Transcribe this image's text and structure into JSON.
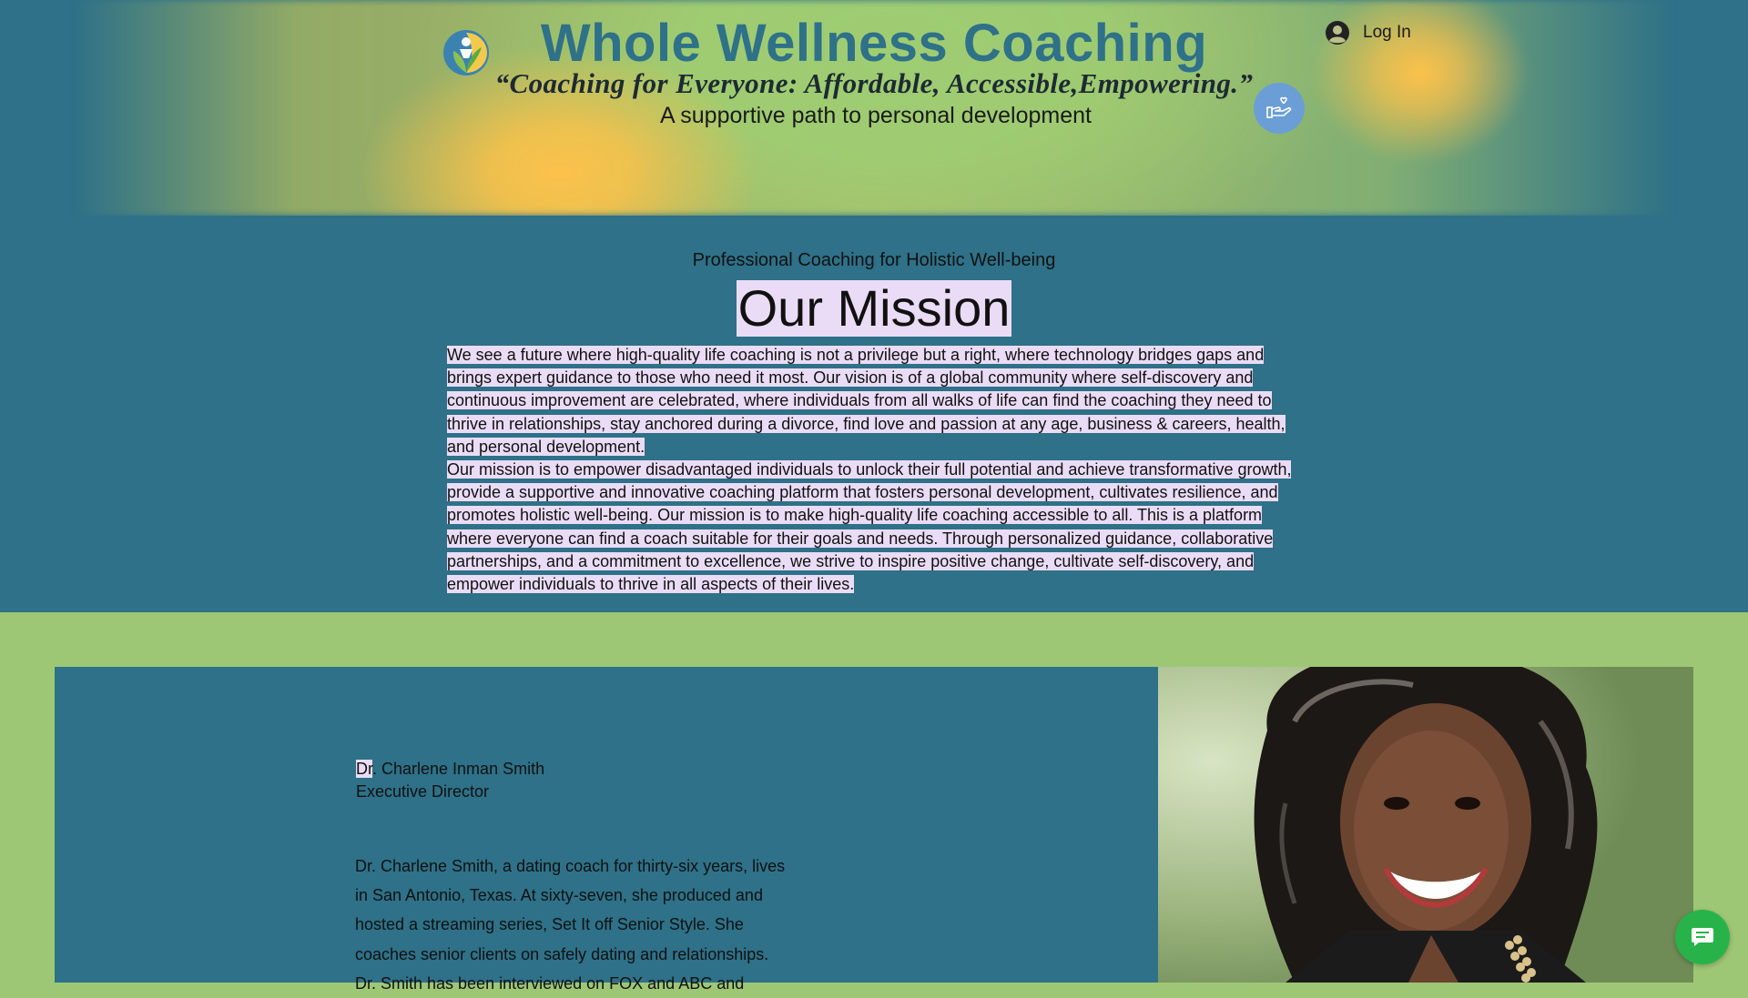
{
  "header": {
    "brand_title": "Whole Wellness Coaching",
    "tagline": "“Coaching for Everyone: Affordable, Accessible,Empowering.”",
    "subtagline": "A supportive path to personal development",
    "login_label": "Log In",
    "logo_icon": "person-leaf-logo-icon",
    "helper_icon": "hand-heart-icon"
  },
  "mission": {
    "kicker": "Professional Coaching for Holistic Well-being",
    "heading": "Our Mission",
    "paragraphs": [
      "We see a future where high-quality life coaching is not a privilege but a right, where technology bridges gaps and brings expert guidance to those who need it most. Our vision is of a global community where self-discovery and continuous improvement are celebrated, where individuals from all walks of life can find the coaching they need to thrive in relationships, stay anchored during a divorce, find love and passion at any age, business & careers, health, and personal development.",
      "Our mission is to empower disadvantaged individuals to unlock their full potential and achieve transformative growth, provide a supportive and innovative coaching platform that fosters personal development, cultivates resilience, and promotes holistic well-being. Our mission is to make high-quality life coaching accessible to all. This is a platform where everyone can find a coach suitable for their goals and needs. Through personalized guidance, collaborative partnerships, and a commitment to excellence, we strive to inspire positive change, cultivate self-discovery, and empower individuals to thrive in all aspects of their lives."
    ]
  },
  "about": {
    "name_prefix": "Dr",
    "name_rest": ". Charlene Inman Smith",
    "role": "Executive Director",
    "bio": "Dr. Charlene Smith, a dating coach for thirty-six years, lives in San Antonio, Texas. At sixty-seven, she produced and hosted a streaming series, Set It off Senior Style. She coaches senior clients on safely dating and relationships. Dr. Smith has been interviewed on FOX and ABC and"
  },
  "chat": {
    "icon": "chat-bubble-icon"
  },
  "colors": {
    "teal": "#2e7188",
    "green": "#9ec775",
    "highlight": "#eadcf6",
    "chat_green": "#28b34a",
    "helper_blue": "#6b9ed6"
  }
}
